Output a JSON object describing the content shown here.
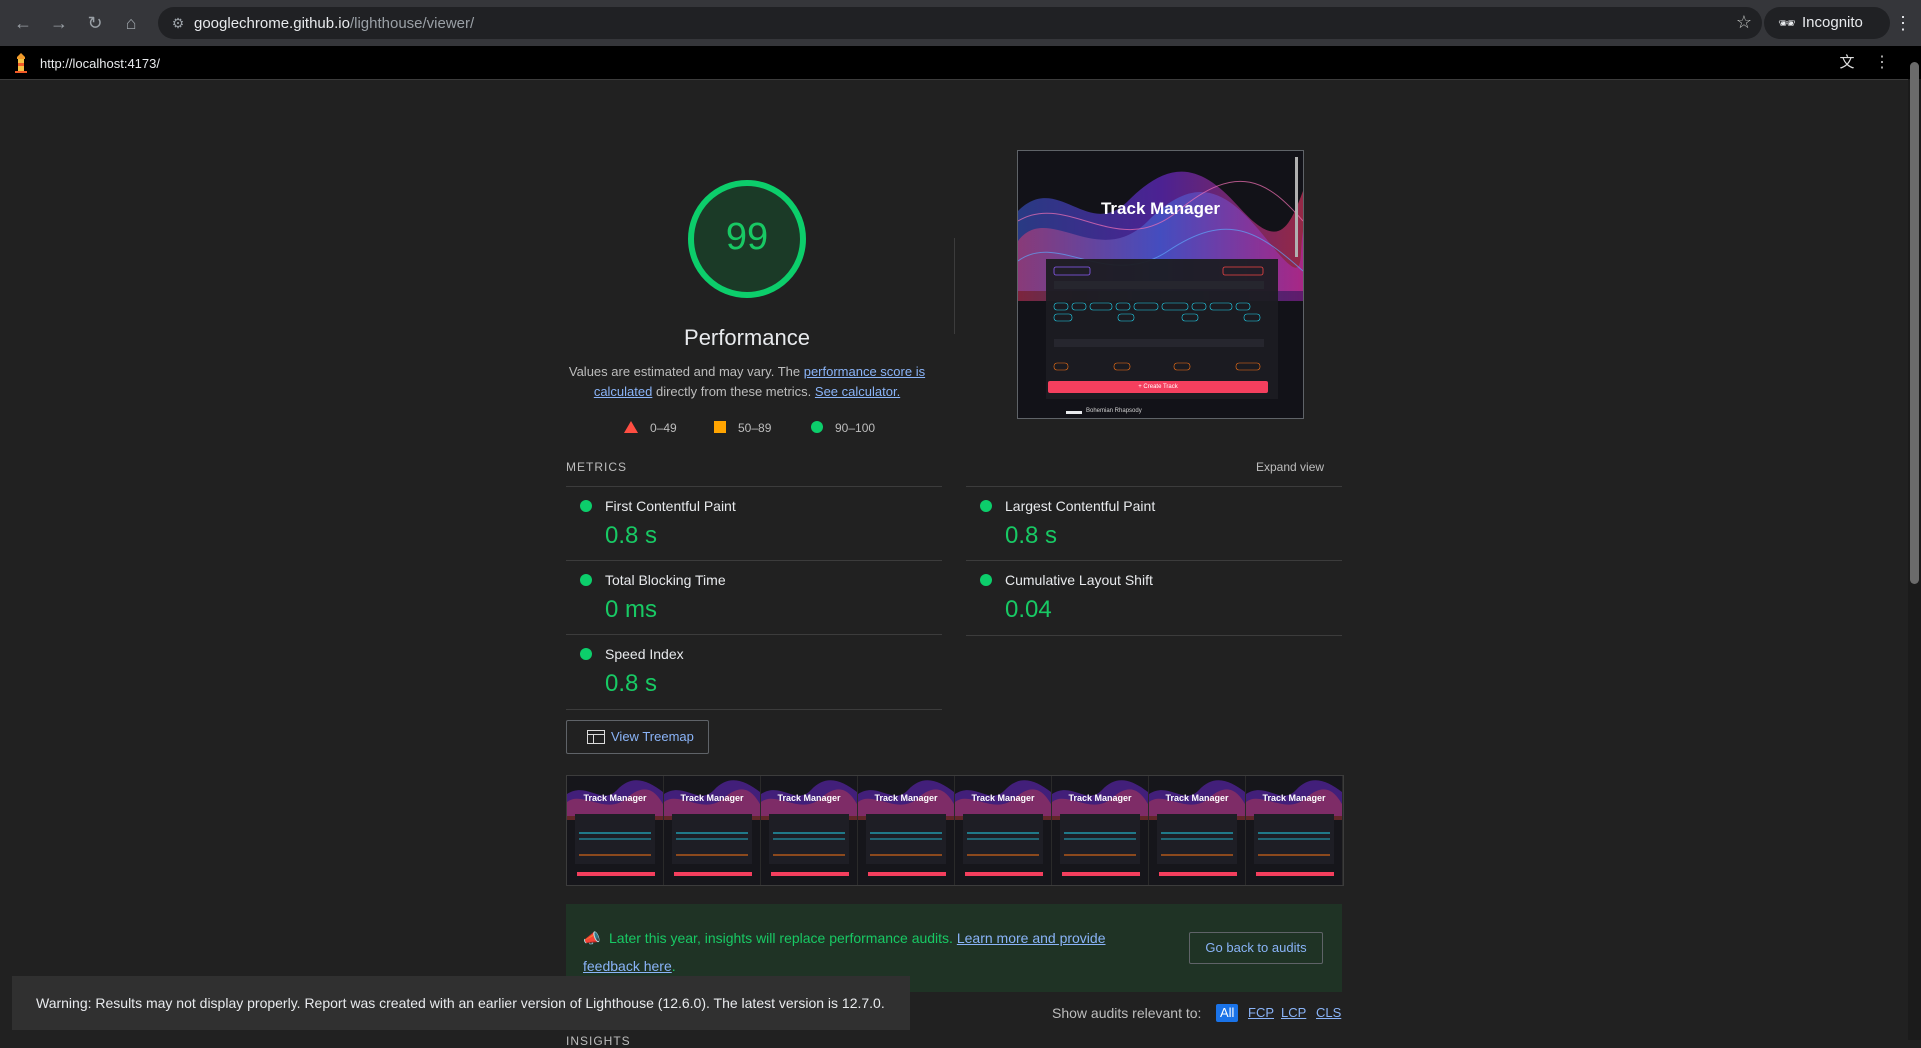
{
  "browser": {
    "nav": {
      "back_icon": "arrow-left-icon",
      "forward_icon": "arrow-right-icon",
      "reload_icon": "reload-icon",
      "home_icon": "home-icon"
    },
    "url_host": "googlechrome.github.io",
    "url_path": "/lighthouse/viewer/",
    "incognito_label": "Incognito"
  },
  "lighthouse_bar": {
    "url": "http://localhost:4173/"
  },
  "performance": {
    "score": "99",
    "title": "Performance",
    "desc_prefix": "Values are estimated and may vary. The ",
    "desc_link1": "performance score is calculated",
    "desc_middle": " directly from these metrics. ",
    "desc_link2": "See calculator.",
    "legend": [
      "0–49",
      "50–89",
      "90–100"
    ],
    "colors": {
      "pass": "#0cce6b",
      "average": "#ffa400",
      "fail": "#ff4e42"
    }
  },
  "preview": {
    "app_title": "Track Manager",
    "footer_track": "Bohemian Rhapsody",
    "create_button": "+ Create Track"
  },
  "metrics": {
    "heading": "METRICS",
    "expand_label": "Expand view",
    "items": [
      {
        "title": "First Contentful Paint",
        "value": "0.8 s"
      },
      {
        "title": "Largest Contentful Paint",
        "value": "0.8 s"
      },
      {
        "title": "Total Blocking Time",
        "value": "0 ms"
      },
      {
        "title": "Cumulative Layout Shift",
        "value": "0.04"
      },
      {
        "title": "Speed Index",
        "value": "0.8 s"
      }
    ]
  },
  "treemap_label": "View Treemap",
  "filmstrip": {
    "frame_title": "Track Manager",
    "frames": [
      "Track Manager",
      "Track Manager",
      "Track Manager",
      "Track Manager",
      "Track Manager",
      "Track Manager",
      "Track Manager",
      "Track Manager"
    ]
  },
  "insights": {
    "message": "Later this year, insights will replace performance audits.",
    "link": "Learn more and provide feedback here",
    "trail": ".",
    "button": "Go back to audits"
  },
  "filters": {
    "label": "Show audits relevant to:",
    "options": [
      "All",
      "FCP",
      "LCP",
      "CLS"
    ],
    "selected": "All"
  },
  "section_cut": "INSIGHTS",
  "toast": "Warning: Results may not display properly. Report was created with an earlier version of Lighthouse (12.6.0). The latest version is 12.7.0."
}
